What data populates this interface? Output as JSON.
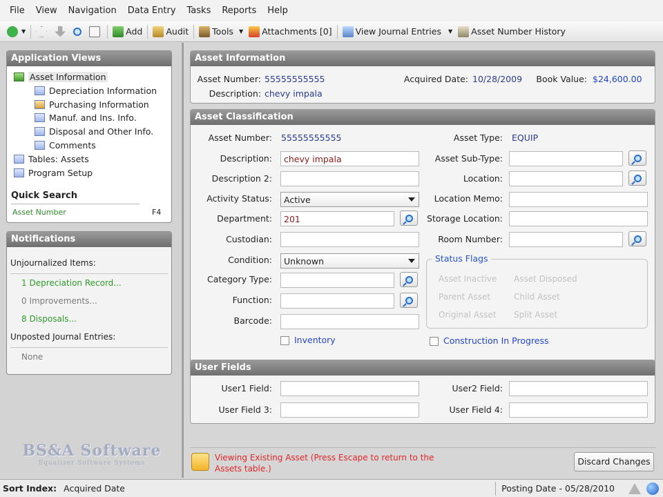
{
  "menu": [
    "File",
    "View",
    "Navigation",
    "Data Entry",
    "Tasks",
    "Reports",
    "Help"
  ],
  "toolbar": {
    "add": "Add",
    "audit": "Audit",
    "tools": "Tools",
    "attachments": "Attachments [0]",
    "view_journal": "View Journal Entries",
    "asset_history": "Asset Number History"
  },
  "app_views": {
    "title": "Application Views",
    "items": [
      "Asset Information",
      "Depreciation Information",
      "Purchasing Information",
      "Manuf. and Ins. Info.",
      "Disposal and Other Info.",
      "Comments",
      "Tables: Assets",
      "Program Setup"
    ],
    "quick_search_title": "Quick Search",
    "quick_search_field": "Asset Number",
    "quick_search_key": "F4"
  },
  "notifications": {
    "title": "Notifications",
    "unjournalized_label": "Unjournalized Items:",
    "items": [
      "1 Depreciation Record...",
      "0 Improvements...",
      "8 Disposals..."
    ],
    "unposted_label": "Unposted Journal Entries:",
    "unposted_value": "None"
  },
  "logo": {
    "text": "BS&A Software",
    "sub": "Equalizer Software Systems"
  },
  "asset_info": {
    "title": "Asset Information",
    "asset_number_label": "Asset Number:",
    "asset_number": "55555555555",
    "description_label": "Description:",
    "description": "chevy impala",
    "acquired_label": "Acquired Date:",
    "acquired": "10/28/2009",
    "book_value_label": "Book Value:",
    "book_value": "$24,600.00"
  },
  "classification": {
    "title": "Asset Classification",
    "asset_number_label": "Asset Number:",
    "asset_number": "55555555555",
    "description_label": "Description:",
    "description": "chevy impala",
    "description2_label": "Description 2:",
    "activity_label": "Activity Status:",
    "activity": "Active",
    "department_label": "Department:",
    "department": "201",
    "custodian_label": "Custodian:",
    "condition_label": "Condition:",
    "condition": "Unknown",
    "category_label": "Category Type:",
    "function_label": "Function:",
    "barcode_label": "Barcode:",
    "inventory_label": "Inventory",
    "asset_type_label": "Asset Type:",
    "asset_type": "EQUIP",
    "sub_type_label": "Asset Sub-Type:",
    "location_label": "Location:",
    "location_memo_label": "Location Memo:",
    "storage_label": "Storage Location:",
    "room_label": "Room Number:",
    "status_flags_title": "Status Flags",
    "flags": [
      "Asset Inactive",
      "Asset Disposed",
      "Parent Asset",
      "Child Asset",
      "Original Asset",
      "Split Asset"
    ],
    "construction_label": "Construction In Progress"
  },
  "user_fields": {
    "title": "User Fields",
    "u1": "User1 Field:",
    "u2": "User2 Field:",
    "u3": "User Field 3:",
    "u4": "User Field 4:"
  },
  "message": "Viewing Existing Asset (Press Escape to return to the Assets table.)",
  "discard_button": "Discard Changes",
  "status": {
    "sort_label": "Sort Index:",
    "sort_value": "Acquired Date",
    "posting": "Posting Date - 05/28/2010"
  }
}
